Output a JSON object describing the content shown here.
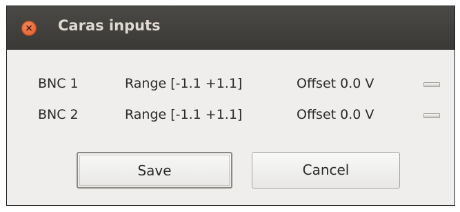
{
  "window": {
    "title": "Caras inputs",
    "close_glyph": "×"
  },
  "rows": [
    {
      "name": "BNC 1",
      "range": "Range [-1.1 +1.1]",
      "offset": "Offset  0.0 V"
    },
    {
      "name": "BNC 2",
      "range": "Range [-1.1 +1.1]",
      "offset": "Offset  0.0 V"
    }
  ],
  "buttons": {
    "save": "Save",
    "cancel": "Cancel"
  },
  "colors": {
    "titlebar": "#3c3b37",
    "close_button": "#e95420",
    "window_bg": "#efeeed"
  }
}
